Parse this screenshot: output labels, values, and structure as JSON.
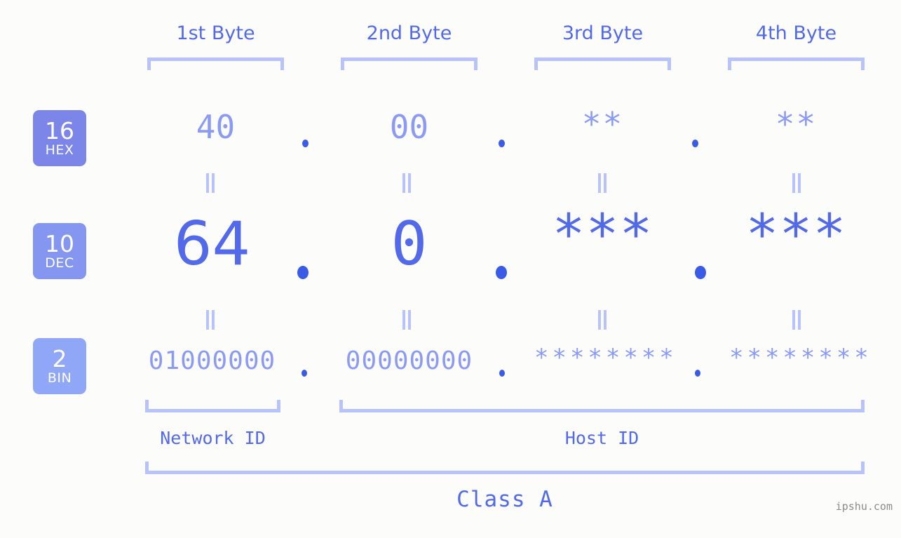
{
  "background_color": "#fcfdfa",
  "accent_color": "#5269ea",
  "muted_color": "#8b9bf3",
  "bracket_color": "#b8c2fb",
  "header": {
    "bytes": [
      {
        "label": "1st Byte"
      },
      {
        "label": "2nd Byte"
      },
      {
        "label": "3rd Byte"
      },
      {
        "label": "4th Byte"
      }
    ]
  },
  "rows": [
    {
      "badge_number": "16",
      "badge_name": "HEX",
      "badge_color": "#7b86e8",
      "values": [
        "40",
        "00",
        "**",
        "**"
      ],
      "separator": "."
    },
    {
      "badge_number": "10",
      "badge_name": "DEC",
      "badge_color": "#8496f0",
      "values": [
        "64",
        "0",
        "***",
        "***"
      ],
      "separator": "."
    },
    {
      "badge_number": "2",
      "badge_name": "BIN",
      "badge_color": "#90a6f6",
      "values": [
        "01000000",
        "00000000",
        "********",
        "********"
      ],
      "separator": "."
    }
  ],
  "equality_marks": {
    "glyph": "||",
    "count_per_gap": 4
  },
  "footer": {
    "network_id_label": "Network ID",
    "host_id_label": "Host ID",
    "class_label": "Class A",
    "watermark": "ipshu.com"
  }
}
